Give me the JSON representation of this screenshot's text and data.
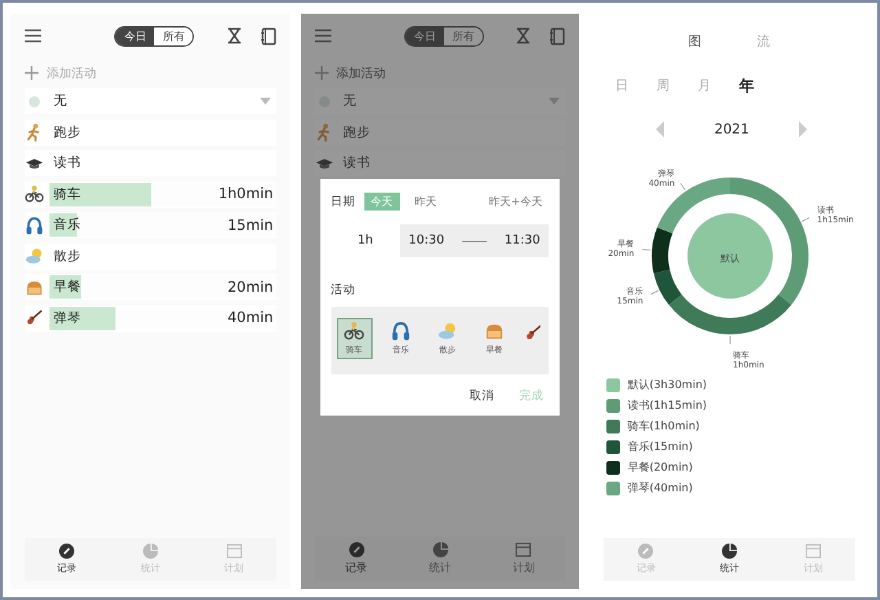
{
  "record_screen": {
    "scope_tabs": [
      {
        "label": "今日",
        "selected": true
      },
      {
        "label": "所有",
        "selected": false
      }
    ],
    "add_placeholder": "添加活动",
    "current": {
      "label": "无"
    },
    "activities": [
      {
        "name": "跑步"
      },
      {
        "name": "读书"
      },
      {
        "name": "骑车",
        "duration": "1h0min",
        "level": 0.45
      },
      {
        "name": "音乐",
        "duration": "15min",
        "level": 0.12
      },
      {
        "name": "散步"
      },
      {
        "name": "早餐",
        "duration": "20min",
        "level": 0.14
      },
      {
        "name": "弹琴",
        "duration": "40min",
        "level": 0.29
      }
    ],
    "nav": [
      {
        "label": "记录",
        "selected": true
      },
      {
        "label": "统计",
        "selected": false
      },
      {
        "label": "计划",
        "selected": false
      }
    ]
  },
  "dialog_screen": {
    "scope_tabs": [
      {
        "label": "今日",
        "selected": true
      },
      {
        "label": "所有",
        "selected": false
      }
    ],
    "add_placeholder": "添加活动",
    "current": {
      "label": "无"
    },
    "activities": [
      {
        "name": "跑步"
      },
      {
        "name": "读书"
      }
    ],
    "nav": [
      {
        "label": "记录",
        "selected": true
      },
      {
        "label": "统计",
        "selected": false
      },
      {
        "label": "计划",
        "selected": false
      }
    ],
    "dialog": {
      "date_label": "日期",
      "date_options": [
        {
          "label": "今天",
          "selected": true
        },
        {
          "label": "昨天",
          "selected": false
        },
        {
          "label": "昨天+今天",
          "selected": false
        }
      ],
      "duration": "1h",
      "start": "10:30",
      "end": "11:30",
      "activity_label": "活动",
      "activities": [
        {
          "label": "骑车",
          "selected": true
        },
        {
          "label": "音乐",
          "selected": false
        },
        {
          "label": "散步",
          "selected": false
        },
        {
          "label": "早餐",
          "selected": false
        }
      ],
      "buttons": [
        {
          "label": "取消",
          "kind": "cancel"
        },
        {
          "label": "完成",
          "kind": "confirm"
        }
      ]
    }
  },
  "stats_screen": {
    "view_tabs": [
      {
        "label": "图",
        "selected": true
      },
      {
        "label": "流",
        "selected": false
      }
    ],
    "periods": [
      {
        "label": "日",
        "selected": false
      },
      {
        "label": "周",
        "selected": false
      },
      {
        "label": "月",
        "selected": false
      },
      {
        "label": "年",
        "selected": true
      }
    ],
    "year": "2021",
    "chart_data": {
      "type": "donut",
      "categories": [
        "读书",
        "骑车",
        "音乐",
        "早餐",
        "弹琴"
      ],
      "values": [
        35.71,
        28.57,
        7.14,
        9.52,
        19.06
      ]
    },
    "center_label": "默认",
    "slice_durations": [
      "1h15min",
      "1h0min",
      "15min",
      "20min",
      "40min"
    ],
    "legend": [
      {
        "label": "默认(3h30min)",
        "color": "#8cc7a0"
      },
      {
        "label": "读书(1h15min)",
        "color": "#5e9c76"
      },
      {
        "label": "骑车(1h0min)",
        "color": "#3f7a59"
      },
      {
        "label": "音乐(15min)",
        "color": "#1f5539"
      },
      {
        "label": "早餐(20min)",
        "color": "#0d2f1c"
      },
      {
        "label": "弹琴(40min)",
        "color": "#6aa783"
      }
    ],
    "nav": [
      {
        "label": "记录",
        "selected": false
      },
      {
        "label": "统计",
        "selected": true
      },
      {
        "label": "计划",
        "selected": false
      }
    ]
  }
}
